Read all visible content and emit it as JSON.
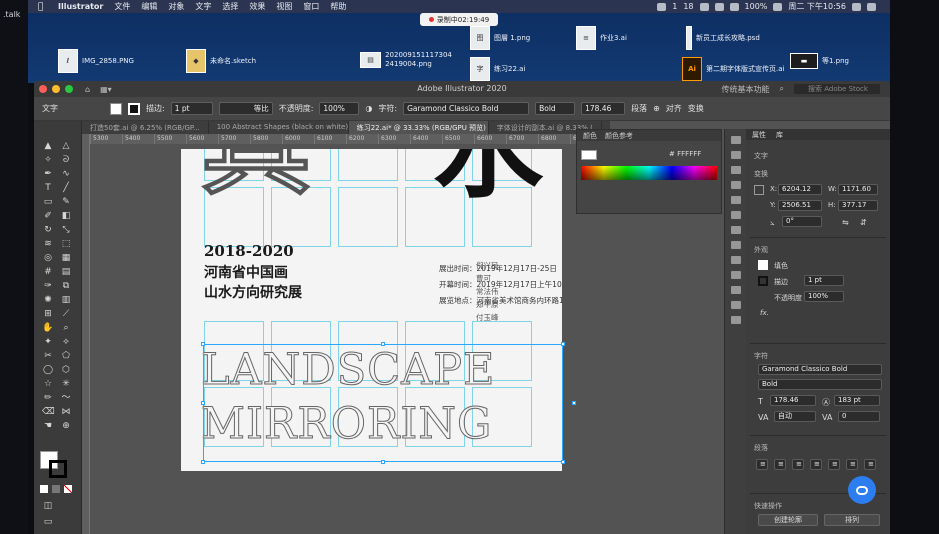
{
  "left_strip_label": ".talk",
  "menubar": {
    "app": "Illustrator",
    "items": [
      "文件",
      "编辑",
      "对象",
      "文字",
      "选择",
      "效果",
      "视图",
      "窗口",
      "帮助"
    ],
    "status": {
      "battery": "100%",
      "datetime": "周二 下午10:56",
      "c1": "1",
      "badge_18": "18"
    }
  },
  "recording": {
    "label": "录制中02:19:49"
  },
  "desktop_items": [
    {
      "name": "IMG_2858.PNG",
      "icon": "image-icon"
    },
    {
      "name": "未命名.sketch",
      "icon": "sketch-file-icon"
    },
    {
      "name": "202009151117304 2419004.png",
      "icon": "image-icon"
    },
    {
      "name": "图層 1.png",
      "icon": "image-icon"
    },
    {
      "name": "练习22.ai",
      "icon": "ai-file-icon"
    },
    {
      "name": "作业3.ai",
      "icon": "ai-file-icon"
    },
    {
      "name": "新员工成长攻略.psd",
      "icon": "psd-file-icon"
    },
    {
      "name": "第二期字体版式宣传页.ai",
      "icon": "ai-file-icon"
    },
    {
      "name": "等1.png",
      "icon": "image-icon"
    }
  ],
  "window": {
    "title": "Adobe Illustrator 2020",
    "workspace": "传统基本功能",
    "search_placeholder": "搜索 Adobe Stock"
  },
  "control_bar": {
    "type_label": "文字",
    "stroke_label": "描边:",
    "stroke_value": "1 pt",
    "stroke_style": "等比",
    "opacity_label": "不透明度:",
    "opacity_value": "100%",
    "char_label": "字符:",
    "font_family": "Garamond Classico Bold",
    "font_style": "Bold",
    "font_size": "178.46",
    "paragraph_label": "段落",
    "align_label": "对齐",
    "transform_label": "变换"
  },
  "doc_tabs": [
    {
      "label": "打造50套.ai @ 6.25% (RGB/GP...",
      "active": false
    },
    {
      "label": "100 Abstract Shapes (black on white).ai",
      "active": false
    },
    {
      "label": "练习22.ai* @ 33.33% (RGB/GPU 预览)",
      "active": true
    },
    {
      "label": "字体设计的副本.ai @ 8.33% (",
      "active": false
    }
  ],
  "ruler_ticks": [
    "5300",
    "5400",
    "5500",
    "5600",
    "5700",
    "5800",
    "6000",
    "6100",
    "6200",
    "6300",
    "6400",
    "6500",
    "6600",
    "6700",
    "6800",
    "6900"
  ],
  "artboard": {
    "big_left_char": "具",
    "big_right_char": "水",
    "year_line": "2018-2020",
    "title_line_1": "河南省中国画",
    "title_line_2": "山水方向研究展",
    "info_rows": [
      {
        "label": "展出时间",
        "value": "2019年12月17日-25日"
      },
      {
        "label": "开幕时间",
        "value": "2019年12月17日上午10时"
      },
      {
        "label": "展览地点",
        "value": "河南省美术馆商务内环路1号"
      }
    ],
    "artists": [
      "倪兴民",
      "曹可",
      "常法伟",
      "郑平原",
      "付玉峰"
    ],
    "english_line_1": "LANDSCAPE",
    "english_line_2": "MIRRORING"
  },
  "color_panel": {
    "tabs": [
      "颜色",
      "颜色参考"
    ],
    "hex_label": "#",
    "hex_value": "FFFFFF"
  },
  "properties_panel": {
    "tabs": [
      "属性",
      "库"
    ],
    "section_type": "文字",
    "section_transform": "变换",
    "x": "6204.12",
    "y": "2506.51",
    "w": "1171.60",
    "h": "377.17",
    "angle": "0°",
    "section_appearance": "外观",
    "fill_label": "填色",
    "stroke_label": "描边",
    "stroke_value": "1 pt",
    "opacity_label": "不透明度",
    "opacity_value": "100%",
    "fx_label": "fx.",
    "section_char": "字符",
    "font_family": "Garamond Classico Bold",
    "font_style": "Bold",
    "font_size": "178.46",
    "leading": "183 pt",
    "tracking_auto": "自动",
    "kerning": "0",
    "section_paragraph": "段落",
    "section_quick": "快速操作",
    "btn_outline": "创建轮廓",
    "btn_arrange": "排列"
  },
  "colors": {
    "accent_blue": "#2aa8ff",
    "guide_cyan": "#7fd4e8",
    "app_bg": "#535353"
  }
}
